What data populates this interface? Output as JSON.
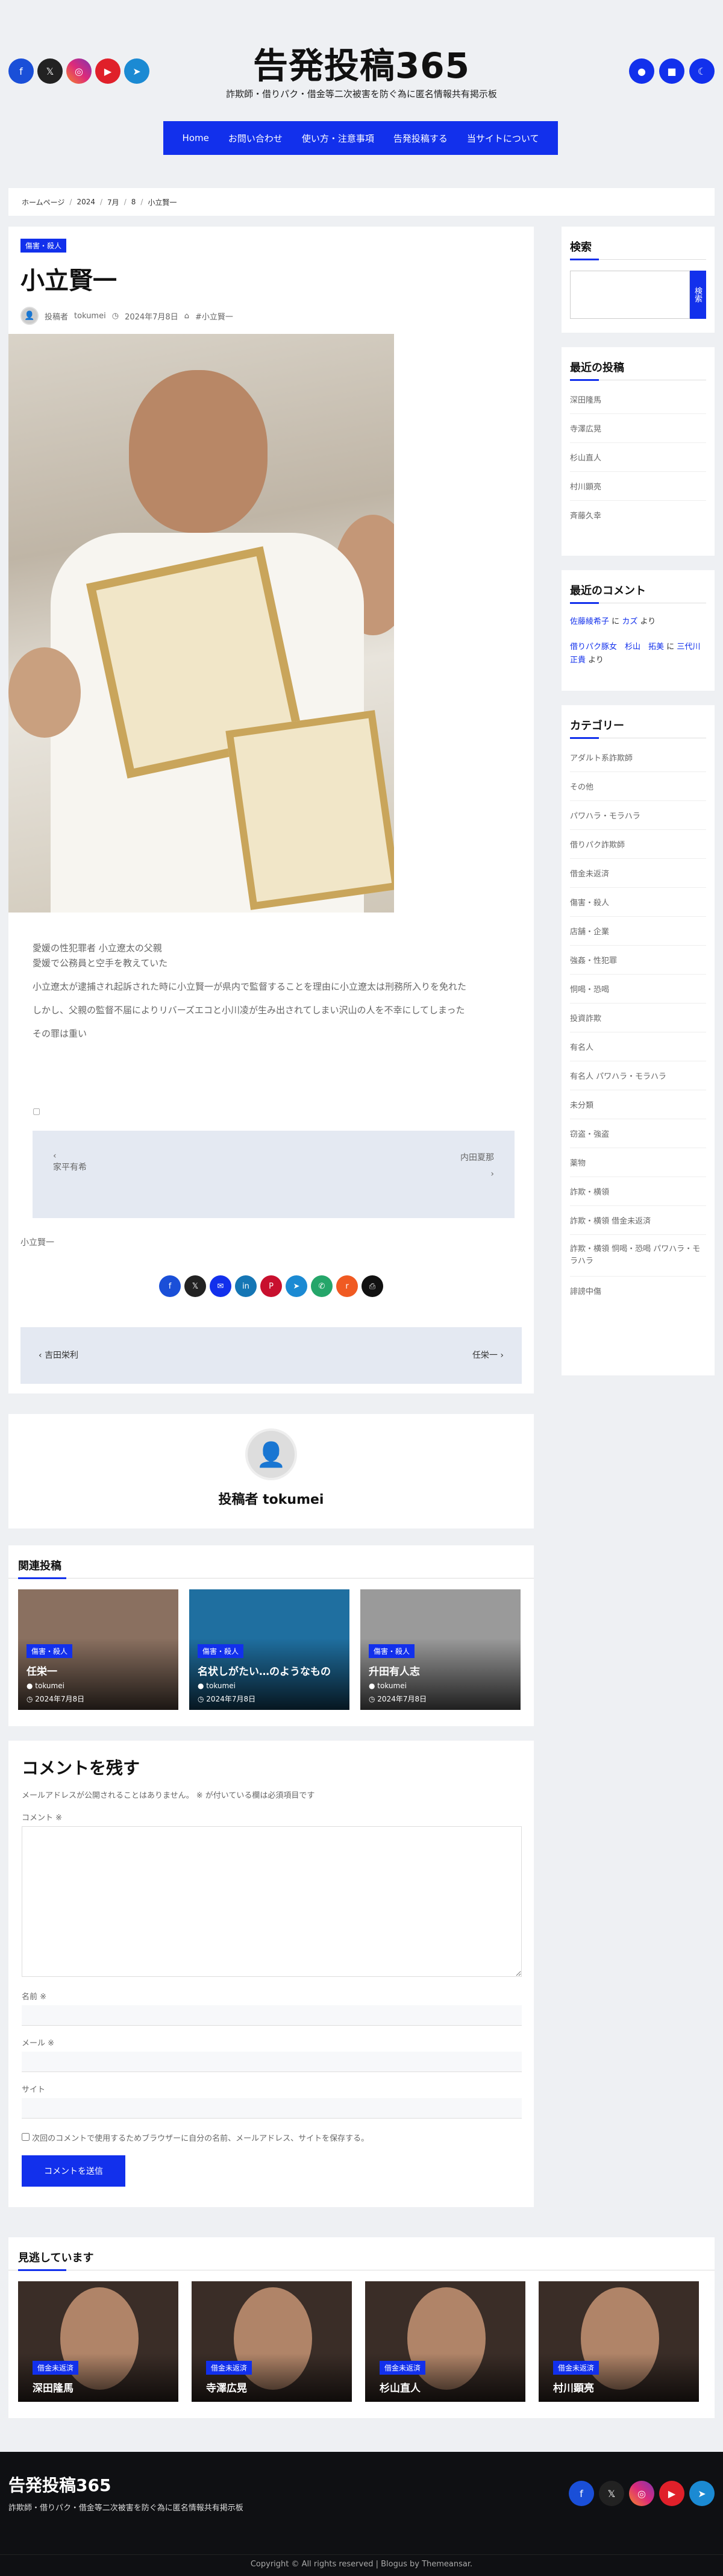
{
  "site": {
    "title": "告発投稿365",
    "description": "詐欺師・借りパク・借金等二次被害を防ぐ為に匿名情報共有掲示板"
  },
  "social_icons": [
    "facebook-icon",
    "x-icon",
    "instagram-icon",
    "youtube-icon",
    "telegram-icon"
  ],
  "header_right_icons": [
    "user-icon",
    "cart-icon",
    "moon-icon"
  ],
  "nav": [
    "Home",
    "お問い合わせ",
    "使い方・注意事項",
    "告発投稿する",
    "当サイトについて"
  ],
  "breadcrumb": [
    "ホームページ",
    "2024",
    "7月",
    "8",
    "小立賢一"
  ],
  "article": {
    "category": "傷害・殺人",
    "title": "小立賢一",
    "author_prefix": "投稿者",
    "author": "tokumei",
    "date": "2024年7月8日",
    "tag": "#小立賢一",
    "paragraphs": [
      "愛媛の性犯罪者 小立遼太の父親\n愛媛で公務員と空手を教えていた",
      "小立遼太が逮捕され起訴された時に小立賢一が県内で監督することを理由に小立遼太は刑務所入りを免れた",
      "しかし、父親の監督不届によりリバーズエコと小川凌が生み出されてしまい沢山の人を不幸にしてしまった",
      "その罪は重い"
    ],
    "postnav_left": "家平有希",
    "postnav_right": "内田夏那",
    "tag_line": "小立賢一",
    "prev": "吉田栄利",
    "next": "任栄一"
  },
  "sidebar": {
    "search_title": "検索",
    "search_button": "検索",
    "recent_title": "最近の投稿",
    "recent": [
      "深田隆馬",
      "寺澤広晃",
      "杉山直人",
      "村川顕亮",
      "斉藤久幸"
    ],
    "comments_title": "最近のコメント",
    "comments": [
      {
        "who": "佐藤綾希子",
        "mid": "に",
        "post": "カズ",
        "end": "より"
      },
      {
        "who": "借りパク豚女　杉山　拓美",
        "mid": "に",
        "post": "三代川正貴",
        "end": "より"
      }
    ],
    "categories_title": "カテゴリー",
    "categories": [
      "アダルト系詐欺師",
      "その他",
      "パワハラ・モラハラ",
      "借りパク詐欺師",
      "借金未返済",
      "傷害・殺人",
      "店舗・企業",
      "強姦・性犯罪",
      "恫喝・恐喝",
      "投資詐欺",
      "有名人",
      "有名人 パワハラ・モラハラ",
      "未分類",
      "窃盗・強盗",
      "薬物",
      "詐欺・横領",
      "詐欺・横領 借金未返済",
      "詐欺・横領 恫喝・恐喝 パワハラ・モラハラ",
      "誹謗中傷"
    ]
  },
  "author_box": {
    "label": "投稿者 tokumei"
  },
  "related": {
    "title": "関連投稿",
    "items": [
      {
        "cat": "傷害・殺人",
        "title": "任栄一",
        "author": "tokumei",
        "date": "2024年7月8日",
        "bg": "#8a7060"
      },
      {
        "cat": "傷害・殺人",
        "title": "名状しがたい…のようなもの",
        "author": "tokumei",
        "date": "2024年7月8日",
        "bg": "#1f6fa0"
      },
      {
        "cat": "傷害・殺人",
        "title": "升田有人志",
        "author": "tokumei",
        "date": "2024年7月8日",
        "bg": "#9a9a9a"
      }
    ]
  },
  "comment_form": {
    "title": "コメントを残す",
    "note": "メールアドレスが公開されることはありません。 ※ が付いている欄は必須項目です",
    "comment_label": "コメント ※",
    "name_label": "名前 ※",
    "email_label": "メール ※",
    "site_label": "サイト",
    "checkbox": "次回のコメントで使用するためブラウザーに自分の名前、メールアドレス、サイトを保存する。",
    "submit": "コメントを送信"
  },
  "missed": {
    "title": "見逃しています",
    "items": [
      {
        "cat": "借金未返済",
        "title": "深田隆馬"
      },
      {
        "cat": "借金未返済",
        "title": "寺澤広晃"
      },
      {
        "cat": "借金未返済",
        "title": "杉山直人"
      },
      {
        "cat": "借金未返済",
        "title": "村川顕亮"
      }
    ]
  },
  "footer": {
    "title": "告発投稿365",
    "desc": "詐欺師・借りパク・借金等二次被害を防ぐ為に匿名情報共有掲示板",
    "copyright": "Copyright © All rights reserved | Blogus by Themeansar."
  },
  "colors": {
    "accent": "#1230ec",
    "bg": "#eef0f3",
    "footer": "#0f1013"
  }
}
